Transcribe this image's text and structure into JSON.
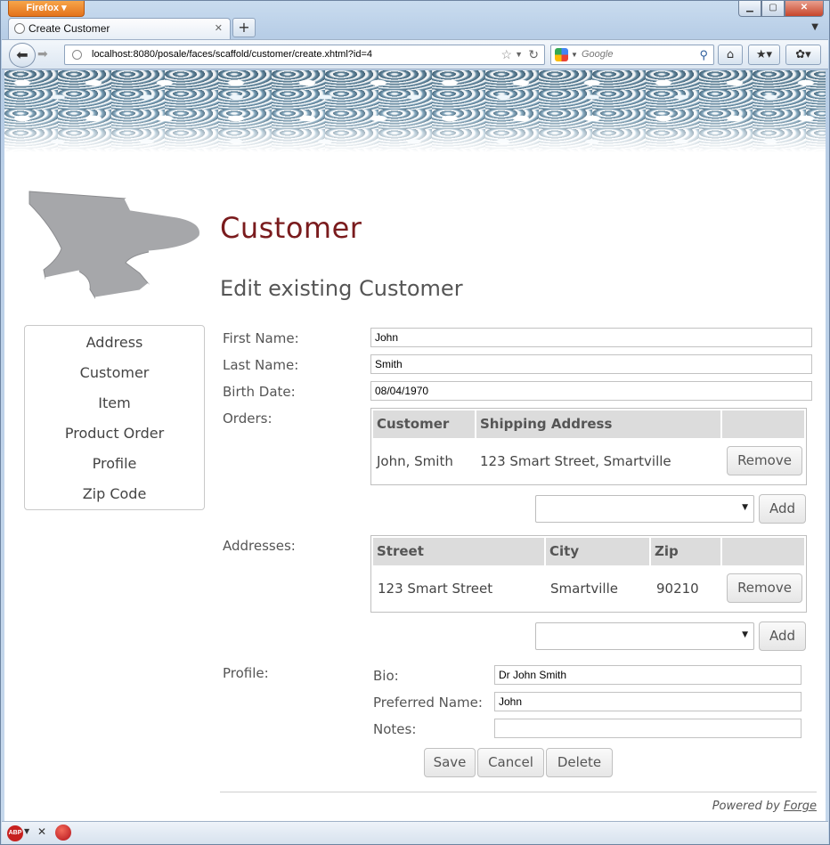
{
  "browser": {
    "menu_button": "Firefox",
    "tab_title": "Create Customer",
    "url": "localhost:8080/posale/faces/scaffold/customer/create.xhtml?id=4",
    "search_placeholder": "Google",
    "new_tab_label": "+"
  },
  "sidebar": {
    "items": [
      {
        "label": "Address"
      },
      {
        "label": "Customer"
      },
      {
        "label": "Item"
      },
      {
        "label": "Product Order"
      },
      {
        "label": "Profile"
      },
      {
        "label": "Zip Code"
      }
    ]
  },
  "page": {
    "heading": "Customer",
    "subheading": "Edit existing Customer"
  },
  "form": {
    "first_name_label": "First Name:",
    "first_name_value": "John",
    "last_name_label": "Last Name:",
    "last_name_value": "Smith",
    "birth_date_label": "Birth Date:",
    "birth_date_value": "08/04/1970",
    "orders_label": "Orders:",
    "orders_table": {
      "headers": [
        "Customer",
        "Shipping Address",
        ""
      ],
      "rows": [
        {
          "customer": "John, Smith",
          "shipping_address": "123 Smart Street, Smartville",
          "action": "Remove"
        }
      ]
    },
    "orders_add_label": "Add",
    "addresses_label": "Addresses:",
    "addresses_table": {
      "headers": [
        "Street",
        "City",
        "Zip",
        ""
      ],
      "rows": [
        {
          "street": "123 Smart Street",
          "city": "Smartville",
          "zip": "90210",
          "action": "Remove"
        }
      ]
    },
    "addresses_add_label": "Add",
    "profile_label": "Profile:",
    "profile": {
      "bio_label": "Bio:",
      "bio_value": "Dr John Smith",
      "preferred_name_label": "Preferred Name:",
      "preferred_name_value": "John",
      "notes_label": "Notes:",
      "notes_value": ""
    }
  },
  "actions": {
    "save": "Save",
    "cancel": "Cancel",
    "delete": "Delete"
  },
  "footer": {
    "powered_by": "Powered by",
    "forge_link": "Forge"
  },
  "statusbar": {
    "abp_label": "ABP"
  },
  "colors": {
    "heading": "#7a1b1d",
    "firefox_button": "#e4731b"
  }
}
